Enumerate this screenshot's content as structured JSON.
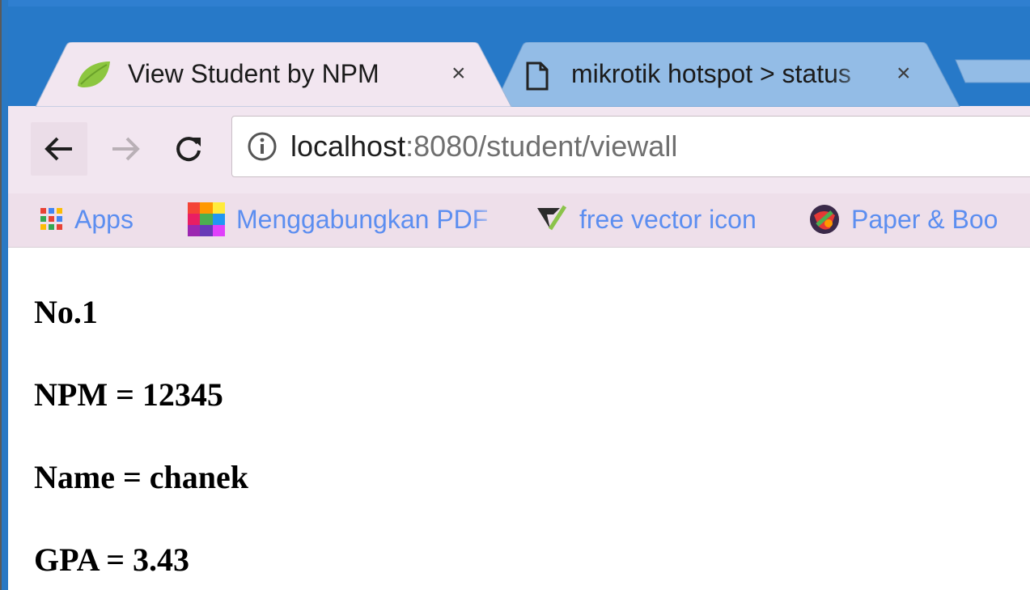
{
  "tabs": [
    {
      "title": "View Student by NPM",
      "icon": "spring-leaf-icon",
      "active": true
    },
    {
      "title": "mikrotik hotspot > status",
      "icon": "document-icon",
      "active": false
    }
  ],
  "tab_close_glyph": "×",
  "nav": {
    "back_icon": "arrow-left-icon",
    "forward_icon": "arrow-right-icon",
    "reload_icon": "reload-icon"
  },
  "address_bar": {
    "host": "localhost",
    "rest": ":8080/student/viewall",
    "security_icon": "info-icon"
  },
  "bookmarks": [
    {
      "label": "Apps",
      "icon": "apps-grid-icon"
    },
    {
      "label": "Menggabungkan PDF",
      "icon": "pdf-merge-icon"
    },
    {
      "label": "free vector icon",
      "icon": "vector-icon"
    },
    {
      "label": "Paper & Boo",
      "icon": "paper-icon"
    }
  ],
  "student": {
    "number": "No.1",
    "npm": "NPM = 12345",
    "name": "Name = chanek",
    "gpa": "GPA = 3.43"
  },
  "colors": {
    "titlebar": "#2779c8",
    "toolbar": "#f2e6f0",
    "bookmark_text": "#5c8ef0"
  }
}
